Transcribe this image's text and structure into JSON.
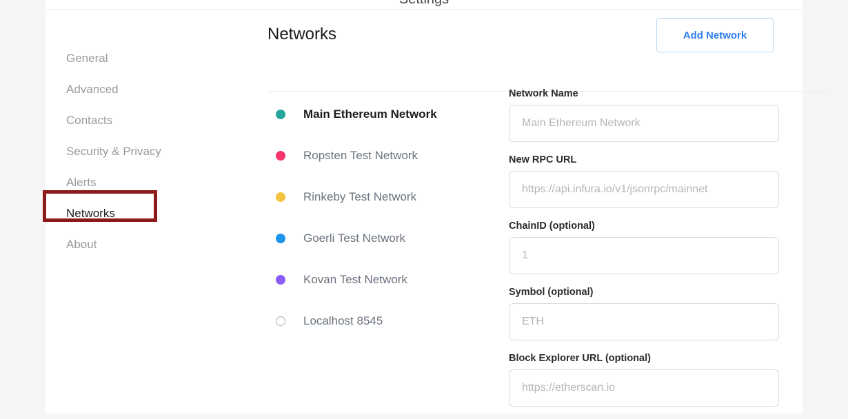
{
  "window": {
    "panel_header_title": "Settings"
  },
  "sidebar": {
    "items": [
      {
        "label": "General",
        "active": false
      },
      {
        "label": "Advanced",
        "active": false
      },
      {
        "label": "Contacts",
        "active": false
      },
      {
        "label": "Security & Privacy",
        "active": false
      },
      {
        "label": "Alerts",
        "active": false
      },
      {
        "label": "Networks",
        "active": true
      },
      {
        "label": "About",
        "active": false
      }
    ]
  },
  "annotation": {
    "target": "Networks",
    "color": "#8B1A1A"
  },
  "content": {
    "title": "Networks",
    "add_network_label": "Add Network"
  },
  "network_list": {
    "items": [
      {
        "label": "Main Ethereum Network",
        "color": "#26a69a",
        "selected": true,
        "hollow": false
      },
      {
        "label": "Ropsten Test Network",
        "color": "#f6336c",
        "selected": false,
        "hollow": false
      },
      {
        "label": "Rinkeby Test Network",
        "color": "#f5c342",
        "selected": false,
        "hollow": false
      },
      {
        "label": "Goerli Test Network",
        "color": "#1e94eb",
        "selected": false,
        "hollow": false
      },
      {
        "label": "Kovan Test Network",
        "color": "#8b5cf6",
        "selected": false,
        "hollow": false
      },
      {
        "label": "Localhost 8545",
        "color": "#b0b0b0",
        "selected": false,
        "hollow": true
      }
    ]
  },
  "form": {
    "fields": [
      {
        "label": "Network Name",
        "value": "",
        "placeholder": "Main Ethereum Network"
      },
      {
        "label": "New RPC URL",
        "value": "",
        "placeholder": "https://api.infura.io/v1/jsonrpc/mainnet"
      },
      {
        "label": "ChainID (optional)",
        "value": "",
        "placeholder": "1"
      },
      {
        "label": "Symbol (optional)",
        "value": "",
        "placeholder": "ETH"
      },
      {
        "label": "Block Explorer URL (optional)",
        "value": "",
        "placeholder": "https://etherscan.io"
      }
    ]
  }
}
